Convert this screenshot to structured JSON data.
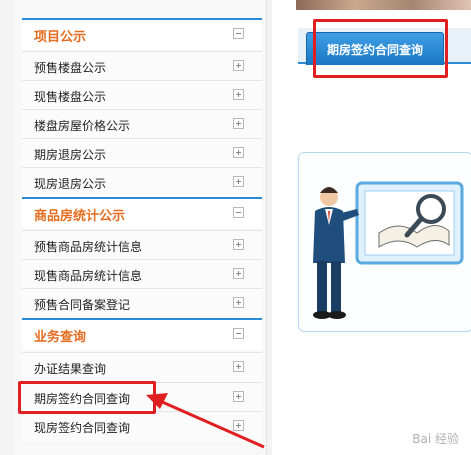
{
  "sidebar": {
    "sections": [
      {
        "title": "项目公示",
        "items": [
          "预售楼盘公示",
          "现售楼盘公示",
          "楼盘房屋价格公示",
          "期房退房公示",
          "现房退房公示"
        ]
      },
      {
        "title": "商品房统计公示",
        "items": [
          "预售商品房统计信息",
          "现售商品房统计信息",
          "预售合同备案登记"
        ]
      },
      {
        "title": "业务查询",
        "items": [
          "办证结果查询",
          "期房签约合同查询",
          "现房签约合同查询"
        ]
      }
    ]
  },
  "main": {
    "tab_label": "期房签约合同查询"
  },
  "colors": {
    "accent": "#2a8bd6",
    "section_title": "#e46c1f",
    "highlight": "#e02020"
  },
  "watermark": "Bai 经验"
}
